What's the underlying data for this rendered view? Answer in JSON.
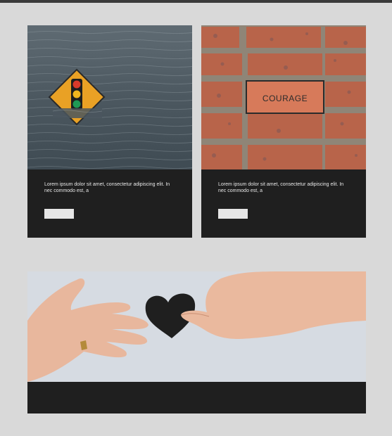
{
  "cards": [
    {
      "image": "flooded-traffic-light-sign",
      "text": "Lorem ipsum dolor sit amet, consectetur adipiscing elit. In nec commodo est, a",
      "button_label": ""
    },
    {
      "image": "courage-brick-wall",
      "sign_text": "COURAGE",
      "text": "Lorem ipsum dolor sit amet, consectetur adipiscing elit. In nec commodo est, a",
      "button_label": ""
    },
    {
      "image": "hands-passing-paper-heart"
    }
  ],
  "colors": {
    "page_background": "#d9d9d9",
    "card_background": "#1f1f1f",
    "card_text": "#e8e8e8",
    "button_fill": "#e6e6e6"
  }
}
